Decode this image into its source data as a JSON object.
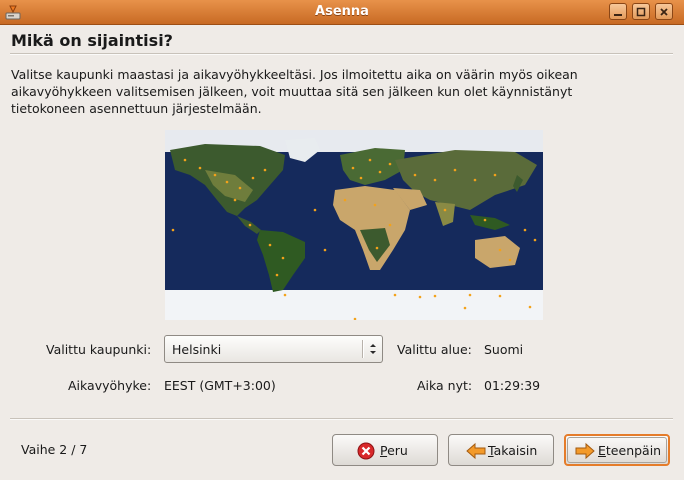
{
  "window": {
    "title": "Asenna"
  },
  "page": {
    "heading": "Mikä on sijaintisi?",
    "description": "Valitse kaupunki maastasi ja aikavyöhykkeeltäsi. Jos ilmoitettu aika on väärin myös oikean aikavyöhykkeen valitsemisen jälkeen, voit muuttaa sitä sen jälkeen kun olet käynnistänyt tietokoneen asennettuun järjestelmään."
  },
  "location": {
    "city_label": "Valittu kaupunki:",
    "city_value": "Helsinki",
    "region_label": "Valittu alue:",
    "region_value": "Suomi",
    "timezone_label": "Aikavyöhyke:",
    "timezone_value": "EEST (GMT+3:00)",
    "time_label": "Aika nyt:",
    "time_value": "01:29:39"
  },
  "footer": {
    "step": "Vaihe 2 / 7",
    "cancel_mnemonic": "P",
    "cancel_rest": "eru",
    "back_mnemonic": "T",
    "back_rest": "akaisin",
    "forward_mnemonic": "E",
    "forward_rest": "teenpäin"
  },
  "colors": {
    "titlebar": "#d47a34",
    "accent": "#e57c2a",
    "map_ocean": "#152a5c",
    "map_land": "#3c5a2e",
    "map_desert": "#c9a66b",
    "map_ice": "#f2f4f7",
    "city_dot": "#f3a21a"
  },
  "icons": {
    "app": "installer-icon",
    "cancel": "stop-icon",
    "back": "arrow-left-icon",
    "forward": "arrow-right-icon"
  }
}
